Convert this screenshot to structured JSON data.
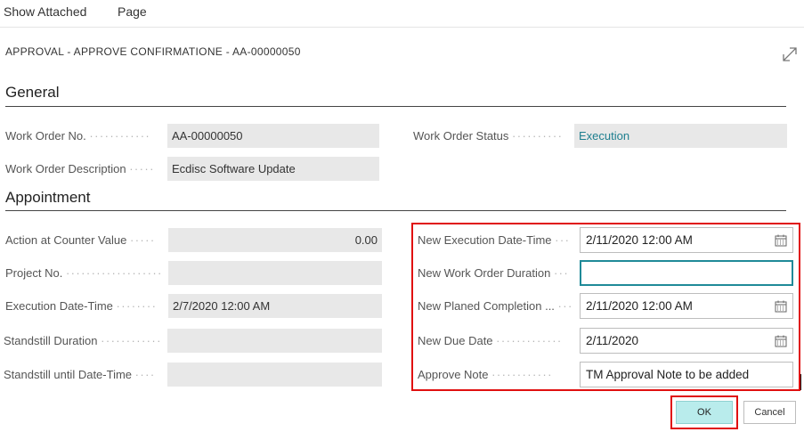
{
  "toolbar": {
    "show_attached": "Show Attached",
    "page": "Page"
  },
  "dialog": {
    "title": "APPROVAL - APPROVE CONFIRMATIONE - AA-00000050"
  },
  "general": {
    "title": "General",
    "work_order_no_label": "Work Order No.",
    "work_order_no_value": "AA-00000050",
    "work_order_status_label": "Work Order Status",
    "work_order_status_value": "Execution",
    "work_order_description_label": "Work Order Description",
    "work_order_description_value": "Ecdisc Software Update"
  },
  "appointment": {
    "title": "Appointment",
    "action_at_counter_label": "Action at Counter Value",
    "action_at_counter_value": "0.00",
    "project_no_label": "Project No.",
    "project_no_value": "",
    "execution_datetime_label": "Execution Date-Time",
    "execution_datetime_value": "2/7/2020 12:00 AM",
    "standstill_duration_label": "Standstill Duration",
    "standstill_duration_value": "",
    "standstill_until_label": "Standstill until Date-Time",
    "standstill_until_value": "",
    "new_execution_datetime_label": "New Execution Date-Time",
    "new_execution_datetime_value": "2/11/2020 12:00 AM",
    "new_work_order_duration_label": "New Work Order Duration",
    "new_work_order_duration_value": "",
    "new_planed_completion_label": "New Planed Completion ...",
    "new_planed_completion_value": "2/11/2020 12:00 AM",
    "new_due_date_label": "New Due Date",
    "new_due_date_value": "2/11/2020",
    "approve_note_label": "Approve Note",
    "approve_note_value": "TM Approval Note to be added"
  },
  "buttons": {
    "ok": "OK",
    "cancel": "Cancel"
  },
  "icons": {
    "expand": "expand-icon",
    "calendar": "calendar-icon"
  },
  "colors": {
    "accent_teal": "#1f8a98",
    "ok_button": "#b9ecec",
    "highlight_red": "#e01010",
    "readonly_field": "#e8e8e8"
  }
}
